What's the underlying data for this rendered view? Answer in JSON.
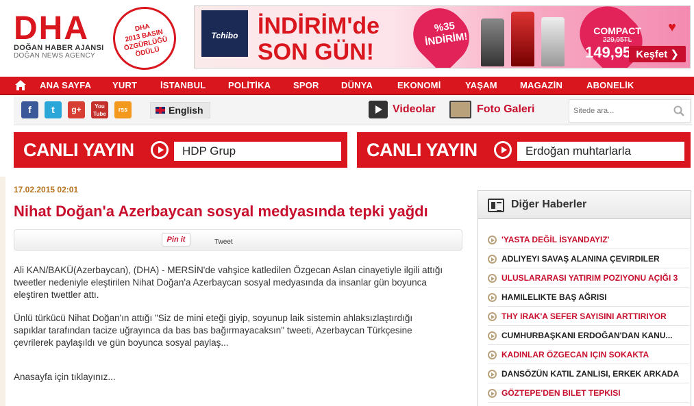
{
  "header": {
    "logo_mark": "DHA",
    "logo_line1": "DOĞAN HABER AJANSI",
    "logo_line2": "DOĞAN NEWS AGENCY",
    "award_lines": [
      "DHA",
      "2013 BASIN",
      "ÖZGÜRLÜĞÜ",
      "ÖDÜLÜ"
    ]
  },
  "banner": {
    "brand": "Tchibo",
    "headline_line1": "İNDİRİM'de",
    "headline_line2": "SON GÜN!",
    "discount_line1": "%35",
    "discount_line2": "İNDİRİM!",
    "compact_label": "COMPACT",
    "old_price": "229,95TL",
    "new_price": "149,95TL",
    "cta": "Keşfet ❯",
    "accent": "#d9161e"
  },
  "nav": {
    "items": [
      "ANA SAYFA",
      "YURT",
      "İSTANBUL",
      "POLİTİKA",
      "SPOR",
      "DÜNYA",
      "EKONOMİ",
      "YAŞAM",
      "MAGAZİN",
      "ABONELİK"
    ]
  },
  "toolbar": {
    "social": [
      "f",
      "t",
      "g+",
      "You Tube",
      "rss"
    ],
    "language": "English",
    "videos": "Videolar",
    "photo_gallery": "Foto Galeri",
    "search_placeholder": "Sitede ara..."
  },
  "live": [
    {
      "label": "CANLI YAYIN",
      "field": "HDP Grup"
    },
    {
      "label": "CANLI YAYIN",
      "field": "Erdoğan muhtarlarla"
    }
  ],
  "article": {
    "date": "17.02.2015 02:01",
    "headline": "Nihat Doğan'a Azerbaycan sosyal medyasında tepki yağdı",
    "pinit": "Pin it",
    "tweet": "Tweet",
    "paragraph1": "Ali KAN/BAKÜ(Azerbaycan), (DHA) - MERSİN'de vahşice katledilen Özgecan Aslan cinayetiyle ilgili attığı tweetler nedeniyle eleştirilen Nihat Doğan'a Azerbaycan sosyal medyasında da insanlar gün boyunca eleştiren twettler attı.",
    "paragraph2": "Ünlü türkücü Nihat Doğan'ın attığı \"Siz de mini eteği giyip, soyunup laik sistemin ahlaksızlaştırdığı sapıklar tarafından tacize uğrayınca da bas bas bağırmayacaksın\" tweeti, Azerbaycan Türkçesine çevrilerek paylaşıldı ve gün boyunca sosyal paylaş...",
    "more_link": "Anasayfa için tıklayınız..."
  },
  "sidebar": {
    "title": "Diğer Haberler",
    "items": [
      {
        "text": "'YASTA DEĞİL İSYANDAYIZ'",
        "style": "red"
      },
      {
        "text": "ADLIYEYI SAVAŞ ALANINA ÇEVIRDILER",
        "style": "dark"
      },
      {
        "text": "ULUSLARARASI YATIRIM POZIYONU AÇIĞI 3",
        "style": "red"
      },
      {
        "text": "HAMILELIKTE BAŞ AĞRISI",
        "style": "dark"
      },
      {
        "text": "THY IRAK'A SEFER SAYISINI ARTTIRIYOR",
        "style": "red"
      },
      {
        "text": "CUMHURBAŞKANI ERDOĞAN'DAN KANU...",
        "style": "dark"
      },
      {
        "text": "KADINLAR ÖZGECAN IÇIN SOKAKTA",
        "style": "red"
      },
      {
        "text": "DANSÖZÜN KATIL ZANLISI, ERKEK ARKADA",
        "style": "dark"
      },
      {
        "text": "GÖZTEPE'DEN BILET TEPKISI",
        "style": "red"
      }
    ]
  }
}
